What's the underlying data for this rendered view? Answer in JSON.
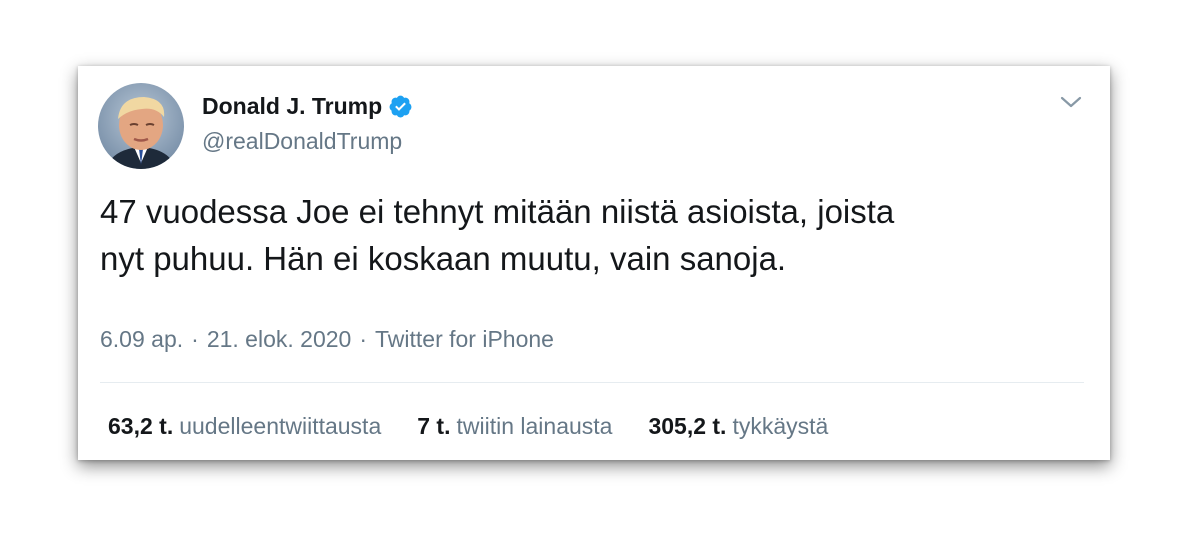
{
  "colors": {
    "text_primary": "#14171a",
    "text_secondary": "#657786",
    "verified_blue": "#1da1f2",
    "divider": "#e6ecf0"
  },
  "tweet": {
    "author": {
      "display_name": "Donald J. Trump",
      "handle": "@realDonaldTrump",
      "verified_icon": "verified-badge-icon"
    },
    "text": "47 vuodessa Joe ei tehnyt mitään niistä asioista, joista\nnyt puhuu. Hän ei koskaan muutu, vain sanoja.",
    "meta": {
      "time": "6.09 ap.",
      "separator": "·",
      "date": "21. elok. 2020",
      "source": "Twitter for iPhone"
    },
    "stats": {
      "retweets": {
        "count": "63,2 t.",
        "label": "uudelleentwiittausta"
      },
      "quotes": {
        "count": "7 t.",
        "label": "twiitin lainausta"
      },
      "likes": {
        "count": "305,2 t.",
        "label": "tykkäystä"
      }
    },
    "menu_icon": "chevron-down-icon"
  }
}
